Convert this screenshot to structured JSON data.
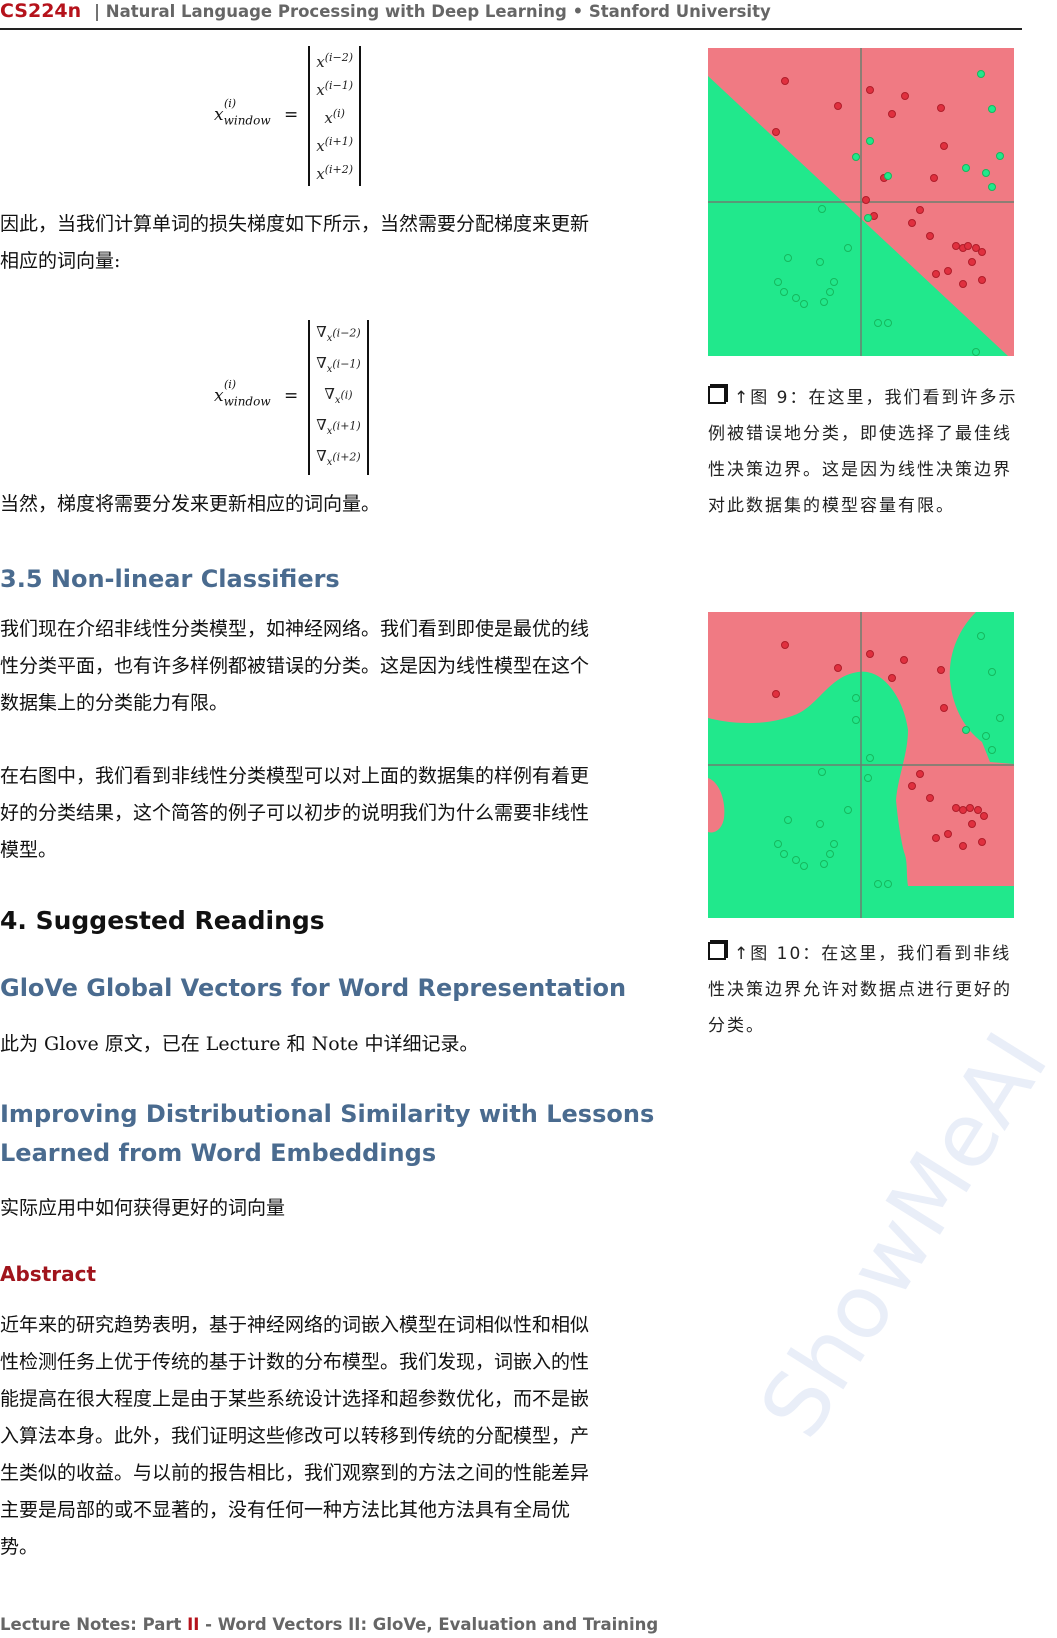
{
  "header": {
    "course": "CS224n",
    "title": "| Natural Language Processing with Deep Learning • Stanford University"
  },
  "equation1": {
    "lhs": "x",
    "lhs_sup": "(i)",
    "lhs_sub": "window",
    "rows": [
      "(i−2)",
      "(i−1)",
      "(i)",
      "(i+1)",
      "(i+2)"
    ]
  },
  "para1": "因此，当我们计算单词的损失梯度如下所示，当然需要分配梯度来更新相应的词向量:",
  "equation2": {
    "lhs": "x",
    "lhs_sup": "(i)",
    "lhs_sub": "window",
    "rows": [
      "(i−2)",
      "(i−1)",
      "(i)",
      "(i+1)",
      "(i+2)"
    ]
  },
  "para2": "当然，梯度将需要分发来更新相应的词向量。",
  "section35": {
    "heading": "3.5 Non-linear Classifiers",
    "p1": "我们现在介绍非线性分类模型，如神经网络。我们看到即使是最优的线性分类平面，也有许多样例都被错误的分类。这是因为线性模型在这个数据集上的分类能力有限。",
    "p2": "在右图中，我们看到非线性分类模型可以对上面的数据集的样例有着更好的分类结果，这个简答的例子可以初步的说明我们为什么需要非线性模型。"
  },
  "section4": {
    "heading": "4.  Suggested Readings",
    "glove_heading": "GloVe Global Vectors for Word Representation",
    "glove_text": "此为 Glove 原文，已在 Lecture 和 Note 中详细记录。",
    "improving_heading_line1": "Improving Distributional Similarity with Lessons",
    "improving_heading_line2": "Learned from Word Embeddings",
    "improving_text": "实际应用中如何获得更好的词向量",
    "abstract_heading": "Abstract",
    "abstract_text": "近年来的研究趋势表明，基于神经网络的词嵌入模型在词相似性和相似性检测任务上优于传统的基于计数的分布模型。我们发现，词嵌入的性能提高在很大程度上是由于某些系统设计选择和超参数优化，而不是嵌入算法本身。此外，我们证明这些修改可以转移到传统的分配模型，产生类似的收益。与以前的报告相比，我们观察到的方法之间的性能差异主要是局部的或不显著的，没有任何一种方法比其他方法具有全局优势。"
  },
  "figure9": {
    "caption": "↑图 9：在这里，我们看到许多示例被错误地分类，即使选择了最佳线性决策边界。这是因为线性决策边界对此数据集的模型容量有限。"
  },
  "figure10": {
    "caption": "↑图 10：在这里，我们看到非线性决策边界允许对数据点进行更好的分类。"
  },
  "colors": {
    "red_region": "#f07a83",
    "green_region": "#21e88c",
    "red_point": "#e0303f",
    "green_point": "#16b85e"
  },
  "footer": {
    "prefix": "Lecture Notes: Part ",
    "part": "II",
    "suffix": " - Word Vectors II: GloVe, Evaluation and Training"
  },
  "watermark": "ShowMeAI"
}
